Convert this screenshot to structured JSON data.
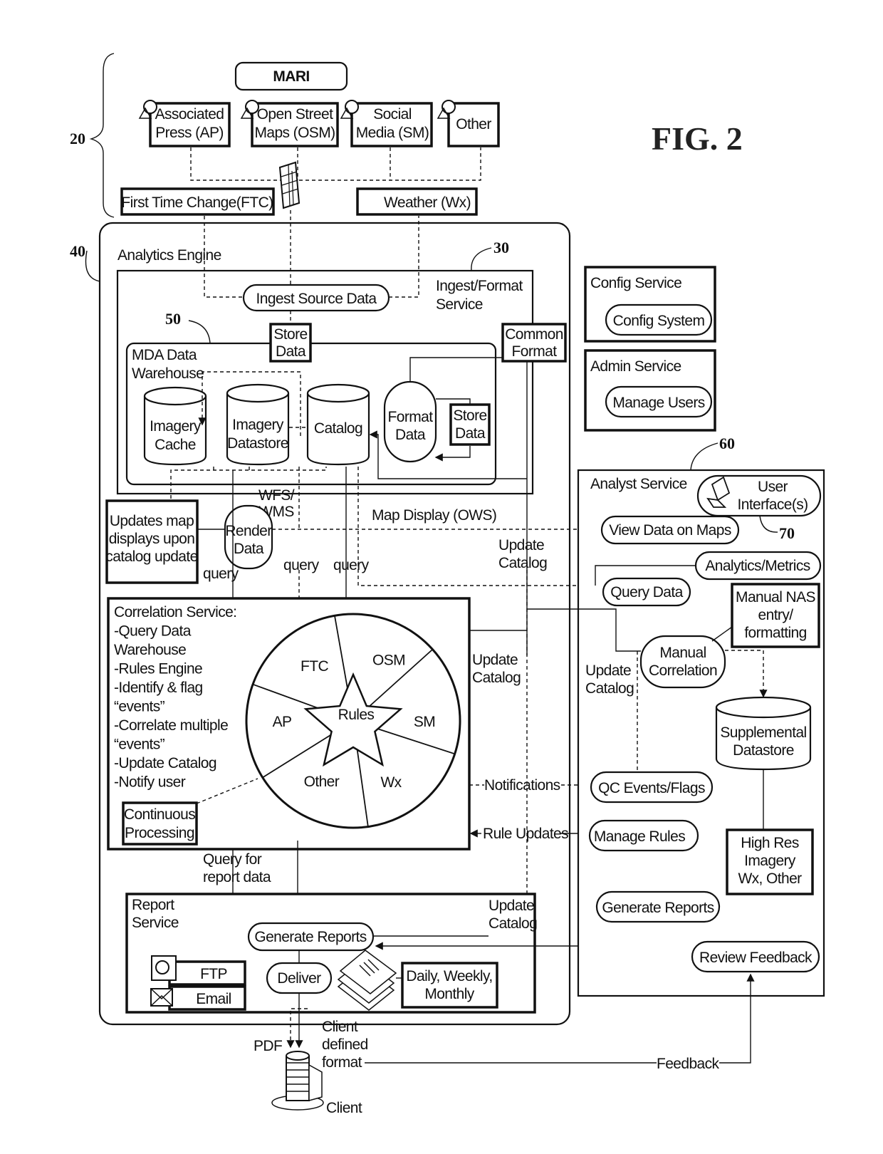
{
  "figure": {
    "title": "FIG. 2"
  },
  "refs": {
    "r20": "20",
    "r30": "30",
    "r40": "40",
    "r50": "50",
    "r60": "60",
    "r70": "70"
  },
  "sources": {
    "mari": "MARI",
    "ap": [
      "Associated",
      "Press (AP)"
    ],
    "osm": [
      "Open Street",
      "Maps (OSM)"
    ],
    "sm": [
      "Social",
      "Media (SM)"
    ],
    "other": "Other",
    "ftc": "First Time Change(FTC)",
    "wx": "Weather (Wx)"
  },
  "analytics_engine": {
    "title": "Analytics Engine",
    "ingest_service": [
      "Ingest/Format",
      "Service"
    ],
    "ingest_source_data": "Ingest Source Data",
    "store_data_top": [
      "Store",
      "Data"
    ],
    "common_format": [
      "Common",
      "Format"
    ],
    "warehouse": {
      "title": [
        "MDA Data",
        "Warehouse"
      ],
      "imagery_cache": [
        "Imagery",
        "Cache"
      ],
      "imagery_datastore": [
        "Imagery",
        "Datastore"
      ],
      "catalog": "Catalog",
      "format_data": [
        "Format",
        "Data"
      ],
      "store_data": [
        "Store",
        "Data"
      ]
    },
    "wfs_wms": [
      "WFS/",
      "WMS"
    ],
    "render_data": [
      "Render",
      "Data"
    ],
    "map_display": "Map Display (OWS)",
    "updates_map": [
      "Updates map",
      "displays upon",
      "catalog update"
    ],
    "query_labels": [
      "query",
      "query",
      "query"
    ],
    "update_catalog": [
      "Update",
      "Catalog"
    ],
    "correlation": {
      "lines": [
        "Correlation Service:",
        "-Query Data",
        "Warehouse",
        "-Rules Engine",
        "-Identify & flag",
        "“events”",
        "-Correlate multiple",
        "“events”",
        "-Update Catalog",
        "-Notify user"
      ],
      "continuous": [
        "Continuous",
        "Processing"
      ],
      "segments": [
        "FTC",
        "OSM",
        "SM",
        "Wx",
        "Other",
        "AP"
      ],
      "rules": "Rules"
    },
    "notifications": "Notifications",
    "rule_updates": "Rule Updates",
    "query_report": [
      "Query for",
      "report data"
    ],
    "report": {
      "title": [
        "Report",
        "Service"
      ],
      "generate": "Generate Reports",
      "deliver": "Deliver",
      "ftp": "FTP",
      "email": "Email",
      "schedule": [
        "Daily, Weekly,",
        "Monthly"
      ],
      "update_catalog": [
        "Update",
        "Catalog"
      ]
    }
  },
  "config_service": {
    "title": "Config Service",
    "action": "Config System"
  },
  "admin_service": {
    "title": "Admin Service",
    "action": "Manage Users"
  },
  "analyst_service": {
    "title": "Analyst Service",
    "ui": [
      "User",
      "Interface(s)"
    ],
    "view_maps": "View Data on Maps",
    "analytics": "Analytics/Metrics",
    "query_data": "Query Data",
    "manual_nas": [
      "Manual NAS",
      "entry/",
      "formatting"
    ],
    "manual_corr": [
      "Manual",
      "Correlation"
    ],
    "update_catalog": [
      "Update",
      "Catalog"
    ],
    "supplemental": [
      "Supplemental",
      "Datastore"
    ],
    "qc_events": "QC Events/Flags",
    "manage_rules": "Manage Rules",
    "high_res": [
      "High Res",
      "Imagery",
      "Wx, Other"
    ],
    "generate_reports": "Generate Reports",
    "review_feedback": "Review Feedback"
  },
  "client": {
    "pdf": "PDF",
    "client_defined": [
      "Client",
      "defined",
      "format"
    ],
    "client": "Client",
    "feedback": "Feedback"
  }
}
